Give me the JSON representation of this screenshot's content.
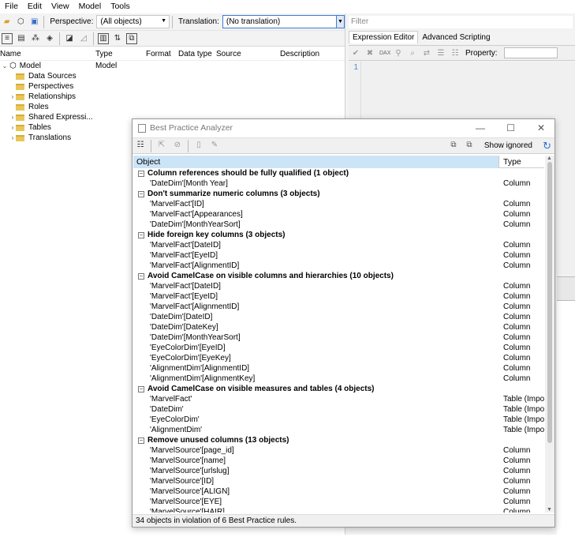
{
  "menu": [
    "File",
    "Edit",
    "View",
    "Model",
    "Tools"
  ],
  "toolbar": {
    "perspective_label": "Perspective:",
    "perspective_value": "(All objects)",
    "translation_label": "Translation:",
    "translation_value": "(No translation)"
  },
  "tree": {
    "columns": [
      "Name",
      "Type",
      "Format",
      "Data type",
      "Source",
      "Description"
    ],
    "root": {
      "label": "Model",
      "type": "Model"
    },
    "items": [
      {
        "label": "Data Sources",
        "expandable": false
      },
      {
        "label": "Perspectives",
        "expandable": false
      },
      {
        "label": "Relationships",
        "expandable": true
      },
      {
        "label": "Roles",
        "expandable": false
      },
      {
        "label": "Shared Expressi...",
        "expandable": true
      },
      {
        "label": "Tables",
        "expandable": true
      },
      {
        "label": "Translations",
        "expandable": true
      }
    ]
  },
  "right_pane": {
    "filter_placeholder": "Filter",
    "tabs": [
      "Expression Editor",
      "Advanced Scripting"
    ],
    "property_label": "Property:",
    "line_number": "1"
  },
  "bpa": {
    "title": "Best Practice Analyzer",
    "show_ignored": "Show ignored",
    "col_object": "Object",
    "col_type": "Type",
    "status": "34 objects in violation of 6 Best Practice rules.",
    "rows": [
      {
        "kind": "group",
        "label": "Column references should be fully qualified (1 object)"
      },
      {
        "kind": "item",
        "label": "'DateDim'[Month Year]",
        "type": "Column"
      },
      {
        "kind": "group",
        "label": "Don't summarize numeric columns (3 objects)"
      },
      {
        "kind": "item",
        "label": "'MarvelFact'[ID]",
        "type": "Column"
      },
      {
        "kind": "item",
        "label": "'MarvelFact'[Appearances]",
        "type": "Column"
      },
      {
        "kind": "item",
        "label": "'DateDim'[MonthYearSort]",
        "type": "Column"
      },
      {
        "kind": "group",
        "label": "Hide foreign key columns (3 objects)"
      },
      {
        "kind": "item",
        "label": "'MarvelFact'[DateID]",
        "type": "Column"
      },
      {
        "kind": "item",
        "label": "'MarvelFact'[EyeID]",
        "type": "Column"
      },
      {
        "kind": "item",
        "label": "'MarvelFact'[AlignmentID]",
        "type": "Column"
      },
      {
        "kind": "group",
        "label": "Avoid CamelCase on visible columns and hierarchies (10 objects)"
      },
      {
        "kind": "item",
        "label": "'MarvelFact'[DateID]",
        "type": "Column"
      },
      {
        "kind": "item",
        "label": "'MarvelFact'[EyeID]",
        "type": "Column"
      },
      {
        "kind": "item",
        "label": "'MarvelFact'[AlignmentID]",
        "type": "Column"
      },
      {
        "kind": "item",
        "label": "'DateDim'[DateID]",
        "type": "Column"
      },
      {
        "kind": "item",
        "label": "'DateDim'[DateKey]",
        "type": "Column"
      },
      {
        "kind": "item",
        "label": "'DateDim'[MonthYearSort]",
        "type": "Column"
      },
      {
        "kind": "item",
        "label": "'EyeColorDim'[EyeID]",
        "type": "Column"
      },
      {
        "kind": "item",
        "label": "'EyeColorDim'[EyeKey]",
        "type": "Column"
      },
      {
        "kind": "item",
        "label": "'AlignmentDim'[AlignmentID]",
        "type": "Column"
      },
      {
        "kind": "item",
        "label": "'AlignmentDim'[AlignmentKey]",
        "type": "Column"
      },
      {
        "kind": "group",
        "label": "Avoid CamelCase on visible measures and tables (4 objects)"
      },
      {
        "kind": "item",
        "label": "'MarvelFact'",
        "type": "Table (Impo"
      },
      {
        "kind": "item",
        "label": "'DateDim'",
        "type": "Table (Impo"
      },
      {
        "kind": "item",
        "label": "'EyeColorDim'",
        "type": "Table (Impo"
      },
      {
        "kind": "item",
        "label": "'AlignmentDim'",
        "type": "Table (Impo"
      },
      {
        "kind": "group",
        "label": "Remove unused columns (13 objects)"
      },
      {
        "kind": "item",
        "label": "'MarvelSource'[page_id]",
        "type": "Column"
      },
      {
        "kind": "item",
        "label": "'MarvelSource'[name]",
        "type": "Column"
      },
      {
        "kind": "item",
        "label": "'MarvelSource'[urlslug]",
        "type": "Column"
      },
      {
        "kind": "item",
        "label": "'MarvelSource'[ID]",
        "type": "Column"
      },
      {
        "kind": "item",
        "label": "'MarvelSource'[ALIGN]",
        "type": "Column"
      },
      {
        "kind": "item",
        "label": "'MarvelSource'[EYE]",
        "type": "Column"
      },
      {
        "kind": "item",
        "label": "'MarvelSource'[HAIR]",
        "type": "Column"
      }
    ]
  }
}
